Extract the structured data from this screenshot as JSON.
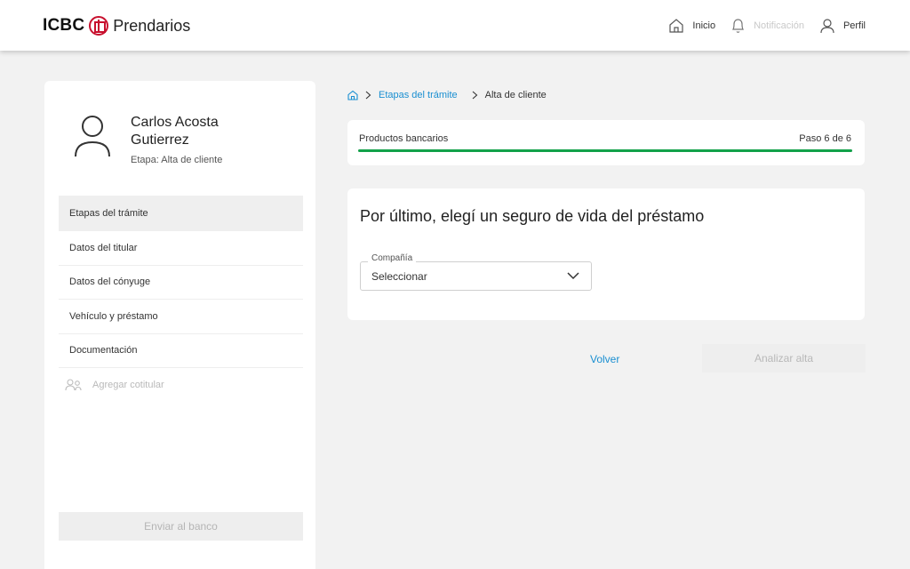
{
  "header": {
    "logo_word": "ICBC",
    "logo_brand": "Prendarios",
    "nav": {
      "home_label": "Inicio",
      "notifications_label": "Notificación",
      "profile_label": "Perfil"
    }
  },
  "sidebar": {
    "user": {
      "first_line": "Carlos Acosta",
      "second_line": "Gutierrez",
      "stage": "Etapa: Alta de cliente"
    },
    "menu": [
      {
        "label": "Etapas del trámite",
        "state": "active"
      },
      {
        "label": "Datos del titular",
        "state": "normal"
      },
      {
        "label": "Datos del cónyuge",
        "state": "normal"
      },
      {
        "label": "Vehículo y préstamo",
        "state": "normal"
      },
      {
        "label": "Documentación",
        "state": "normal"
      },
      {
        "label": "Agregar cotitular",
        "state": "disabled"
      }
    ],
    "send_button": "Enviar al banco"
  },
  "breadcrumb": {
    "icon": "home-icon",
    "link_label": "Etapas del trámite",
    "current_label": "Alta de cliente"
  },
  "progress": {
    "label": "Productos bancarios",
    "step_text": "Paso 6 de 6",
    "fraction": 1.0,
    "color": "#12a14a"
  },
  "form": {
    "title": "Por último, elegí un seguro de vida del préstamo",
    "company_field": {
      "label": "Compañía",
      "value": "Seleccionar"
    }
  },
  "actions": {
    "back_label": "Volver",
    "analyze_label": "Analizar alta"
  },
  "colors": {
    "accent": "#1a8fd1",
    "brand_red": "#c8102e",
    "progress": "#12a14a"
  }
}
